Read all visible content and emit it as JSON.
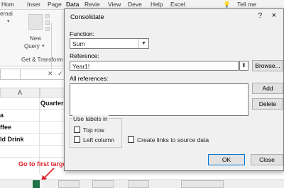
{
  "excel": {
    "tabs": [
      "Hom",
      "Inser",
      "Page",
      "Data",
      "Revie",
      "View",
      "Deve",
      "Help",
      "Excel"
    ],
    "active_tab": "Data",
    "tell_me": "Tell me",
    "ribbon": {
      "external": "ernal",
      "new_label": "New",
      "query_label": "Query",
      "group_label": "Get & Transform"
    },
    "column_header": "A",
    "header_cell": "Quarter",
    "cells": [
      "a",
      "ffee",
      "ld Drink"
    ]
  },
  "annotation": "Go to first targeted sheet",
  "dialog": {
    "title": "Consolidate",
    "help": "?",
    "close": "×",
    "function_label": "Function:",
    "function_value": "Sum",
    "reference_label": "Reference:",
    "reference_value": "Year1!",
    "browse_button": "Browse...",
    "all_references_label": "All references:",
    "add_button": "Add",
    "delete_button": "Delete",
    "use_labels_label": "Use labels in",
    "top_row_label": "Top row",
    "left_column_label": "Left column",
    "create_links_label": "Create links to source data",
    "ok_button": "OK",
    "close_button": "Close"
  }
}
